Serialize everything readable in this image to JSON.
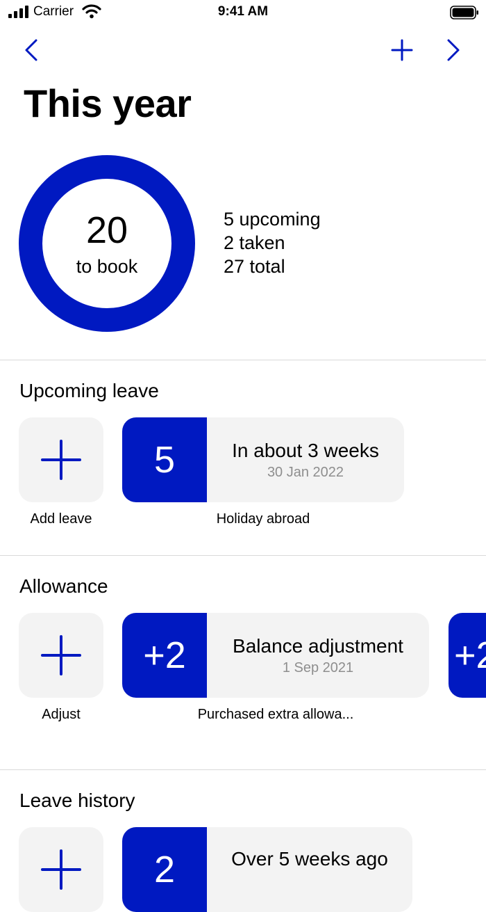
{
  "status_bar": {
    "carrier": "Carrier",
    "time": "9:41 AM"
  },
  "nav": {
    "back_icon": "chevron-left-icon",
    "add_icon": "plus-icon",
    "next_icon": "chevron-right-icon",
    "accent_color": "#0019c1"
  },
  "page": {
    "title": "This year"
  },
  "summary": {
    "to_book_value": "20",
    "to_book_label": "to book",
    "upcoming": "5 upcoming",
    "taken": "2 taken",
    "total": "27 total"
  },
  "upcoming": {
    "title": "Upcoming leave",
    "add_label": "Add leave",
    "cards": [
      {
        "badge": "5",
        "title": "In about 3 weeks",
        "date": "30 Jan 2022",
        "caption": "Holiday abroad"
      }
    ]
  },
  "allowance": {
    "title": "Allowance",
    "add_label": "Adjust",
    "cards": [
      {
        "badge": "+2",
        "title": "Balance adjustment",
        "date": "1 Sep 2021",
        "caption": "Purchased extra allowa..."
      },
      {
        "badge": "+2"
      }
    ]
  },
  "history": {
    "title": "Leave history",
    "cards": [
      {
        "badge": "2",
        "title": "Over 5 weeks ago"
      }
    ]
  },
  "colors": {
    "accent": "#0019c1",
    "tile_bg": "#f3f3f3",
    "secondary_text": "#8e8e8e"
  }
}
